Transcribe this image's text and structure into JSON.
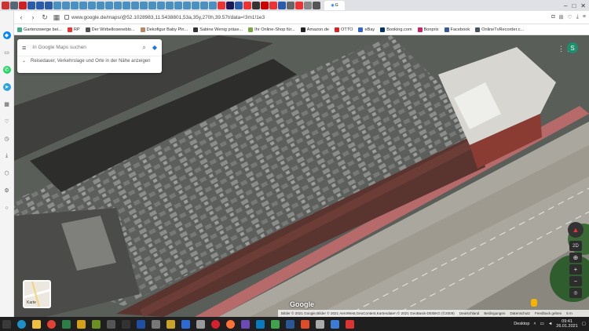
{
  "browser": {
    "active_tab_label": "G",
    "url": "www.google.de/maps/@52.1028983,11.5438801,53a,35y,270h,39.57t/data=!3m1!1e3",
    "win_controls": [
      "–",
      "□",
      "✕"
    ]
  },
  "bookmarks": [
    {
      "label": "Gartenzwerge bei...",
      "color": "#4a8"
    },
    {
      "label": "RP",
      "color": "#e33"
    },
    {
      "label": "Der Wirbelloseneblo...",
      "color": "#555"
    },
    {
      "label": "Dekofigur Baby Pin...",
      "color": "#b86"
    },
    {
      "label": "Sabine Wenig präse...",
      "color": "#333"
    },
    {
      "label": "Ihr Online-Shop für...",
      "color": "#7a4"
    },
    {
      "label": "Amazon.de",
      "color": "#222"
    },
    {
      "label": "OTTO",
      "color": "#d22"
    },
    {
      "label": "eBay",
      "color": "#36c"
    },
    {
      "label": "Booking.com",
      "color": "#036"
    },
    {
      "label": "Bonprix",
      "color": "#c26"
    },
    {
      "label": "Facebook",
      "color": "#3b5998"
    },
    {
      "label": "OnlineTvRecorder.c...",
      "color": "#456"
    }
  ],
  "search": {
    "placeholder": "In Google Maps suchen",
    "nearby_text": "Reisedauer, Verkehrslage und Orte in der Nähe anzeigen"
  },
  "map": {
    "avatar_letter": "S",
    "map_type_label": "Karte",
    "logo": "Google",
    "attribution": [
      "Bilder © 2021 Google,Bilder © 2021 AeroWest,GeoContent,Kartendaten © 2021 GeoBasis-DE/BKG (©2009)",
      "Deutschland",
      "Bedingungen",
      "Datenschutz",
      "Feedback geben",
      "5 m"
    ],
    "controls": {
      "mode_2d": "2D",
      "zoom_in": "+",
      "zoom_out": "−"
    }
  },
  "taskbar": {
    "desktop_label": "Desktop",
    "time": "09:41",
    "date": "26.01.2021"
  }
}
